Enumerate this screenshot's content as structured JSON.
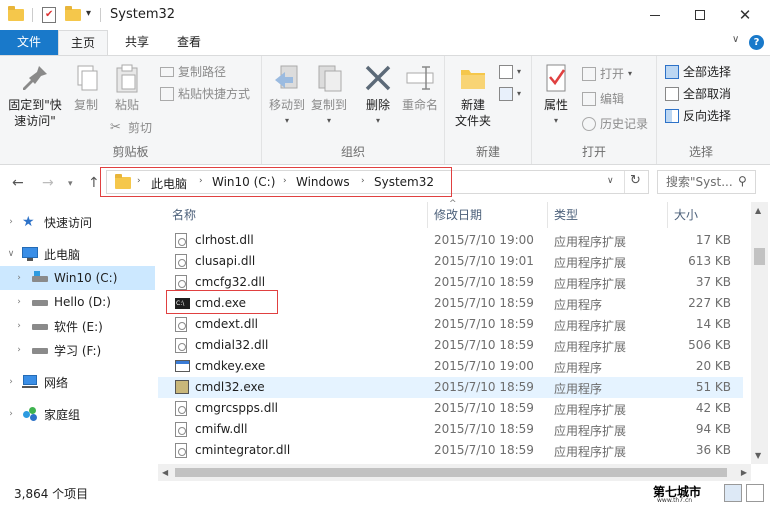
{
  "window": {
    "title": "System32"
  },
  "tabs": {
    "file": "文件",
    "home": "主页",
    "share": "共享",
    "view": "查看"
  },
  "ribbon": {
    "clipboard": {
      "label": "剪贴板",
      "pin_line1": "固定到\"快",
      "pin_line2": "速访问\"",
      "copy": "复制",
      "paste": "粘贴",
      "copy_path": "复制路径",
      "paste_shortcut": "粘贴快捷方式",
      "cut": "剪切"
    },
    "organize": {
      "label": "组织",
      "move_to": "移动到",
      "copy_to": "复制到",
      "delete": "删除",
      "rename": "重命名"
    },
    "new": {
      "label": "新建",
      "new_folder_line1": "新建",
      "new_folder_line2": "文件夹"
    },
    "open": {
      "label": "打开",
      "properties": "属性",
      "open": "打开",
      "edit": "编辑",
      "history": "历史记录"
    },
    "select": {
      "label": "选择",
      "select_all": "全部选择",
      "select_none": "全部取消",
      "invert": "反向选择"
    }
  },
  "address": {
    "crumbs": [
      "此电脑",
      "Win10 (C:)",
      "Windows",
      "System32"
    ],
    "search_placeholder": "搜索\"Syst..."
  },
  "nav_pane": {
    "items": [
      {
        "label": "快速访问",
        "icon": "star-icon"
      },
      {
        "label": "此电脑",
        "icon": "computer-icon"
      },
      {
        "label": "Win10 (C:)",
        "icon": "drive-icon"
      },
      {
        "label": "Hello (D:)",
        "icon": "drive-icon"
      },
      {
        "label": "软件 (E:)",
        "icon": "drive-icon"
      },
      {
        "label": "学习 (F:)",
        "icon": "drive-icon"
      },
      {
        "label": "网络",
        "icon": "network-icon"
      },
      {
        "label": "家庭组",
        "icon": "homegroup-icon"
      }
    ]
  },
  "file_list": {
    "columns": {
      "name": "名称",
      "date": "修改日期",
      "type": "类型",
      "size": "大小"
    },
    "rows": [
      {
        "name": "clrhost.dll",
        "date": "2015/7/10 19:00",
        "type": "应用程序扩展",
        "size": "17 KB",
        "icon": "dll-file-icon"
      },
      {
        "name": "clusapi.dll",
        "date": "2015/7/10 19:01",
        "type": "应用程序扩展",
        "size": "613 KB",
        "icon": "dll-file-icon"
      },
      {
        "name": "cmcfg32.dll",
        "date": "2015/7/10 18:59",
        "type": "应用程序扩展",
        "size": "37 KB",
        "icon": "dll-file-icon"
      },
      {
        "name": "cmd.exe",
        "date": "2015/7/10 18:59",
        "type": "应用程序",
        "size": "227 KB",
        "icon": "cmd-exe-icon"
      },
      {
        "name": "cmdext.dll",
        "date": "2015/7/10 18:59",
        "type": "应用程序扩展",
        "size": "14 KB",
        "icon": "dll-file-icon"
      },
      {
        "name": "cmdial32.dll",
        "date": "2015/7/10 18:59",
        "type": "应用程序扩展",
        "size": "506 KB",
        "icon": "dll-file-icon"
      },
      {
        "name": "cmdkey.exe",
        "date": "2015/7/10 19:00",
        "type": "应用程序",
        "size": "20 KB",
        "icon": "exe-file-icon"
      },
      {
        "name": "cmdl32.exe",
        "date": "2015/7/10 18:59",
        "type": "应用程序",
        "size": "51 KB",
        "icon": "cmdl-exe-icon"
      },
      {
        "name": "cmgrcspps.dll",
        "date": "2015/7/10 18:59",
        "type": "应用程序扩展",
        "size": "42 KB",
        "icon": "dll-file-icon"
      },
      {
        "name": "cmifw.dll",
        "date": "2015/7/10 18:59",
        "type": "应用程序扩展",
        "size": "94 KB",
        "icon": "dll-file-icon"
      },
      {
        "name": "cmintegrator.dll",
        "date": "2015/7/10 18:59",
        "type": "应用程序扩展",
        "size": "36 KB",
        "icon": "dll-file-icon"
      }
    ]
  },
  "status": {
    "count": "3,864 个项目",
    "watermark": "第七城市",
    "watermark_sub": "www.th7.cn"
  },
  "colors": {
    "accent": "#1979ca",
    "highlight_box": "#e04040",
    "selection": "#cce8ff",
    "hover": "#e5f3ff"
  }
}
